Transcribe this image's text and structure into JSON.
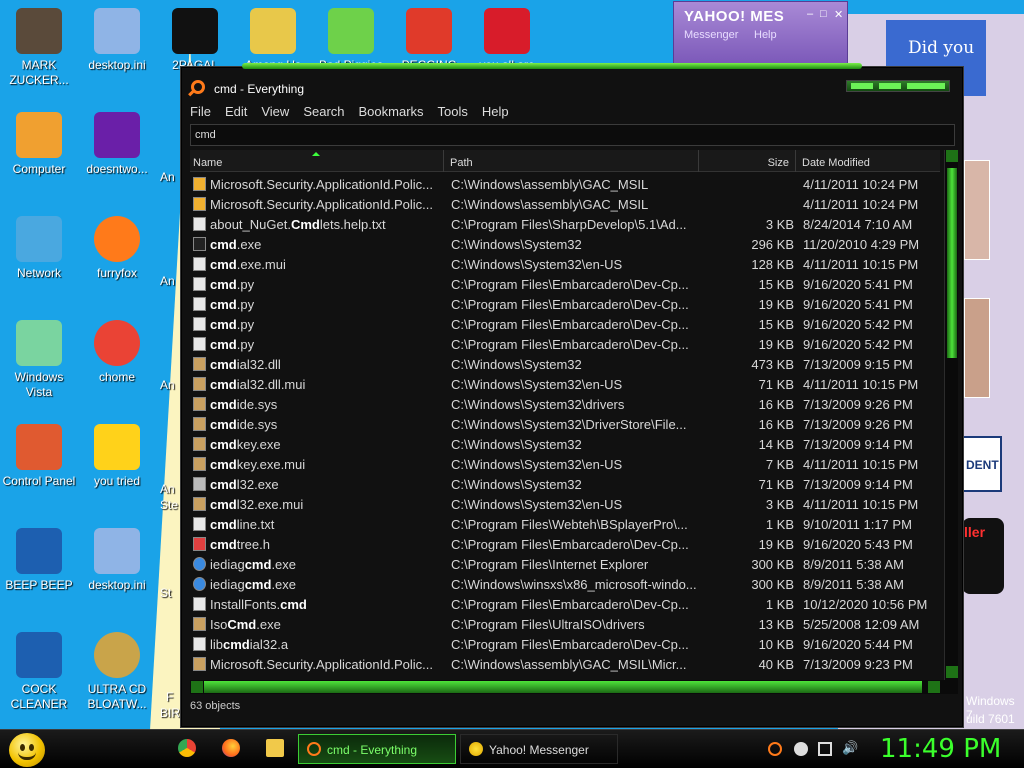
{
  "desktop": {
    "icons": [
      {
        "label": "MARK ZUCKER...",
        "icon": "user-icon",
        "color": "#5a4a3a"
      },
      {
        "label": "desktop.ini",
        "icon": "settings-file-icon",
        "color": "#8fb4e6"
      },
      {
        "label": "2PAGAL",
        "icon": "cmd-icon",
        "color": "#111111"
      },
      {
        "label": "Among Us",
        "icon": "folder-icon",
        "color": "#e8c84a"
      },
      {
        "label": "Bad Piggies",
        "icon": "pig-icon",
        "color": "#6ed14a"
      },
      {
        "label": "PECGINC",
        "icon": "p-app-icon",
        "color": "#e03a2a"
      },
      {
        "label": "you all are",
        "icon": "devcpp-icon",
        "color": "#d81c2a"
      },
      {
        "label": "Computer",
        "icon": "computer-icon",
        "color": "#f0a030"
      },
      {
        "label": "doesntwo...",
        "icon": "yahoo-icon",
        "color": "#6a1fa8"
      },
      {
        "label": "Network",
        "icon": "network-icon",
        "color": "#4aa8e0"
      },
      {
        "label": "furryfox",
        "icon": "firefox-icon",
        "color": "#ff7a1a"
      },
      {
        "label": "Windows Vista",
        "icon": "recycle-bin-icon",
        "color": "#7ad4a0"
      },
      {
        "label": "chome",
        "icon": "chrome-icon",
        "color": "#ea4335"
      },
      {
        "label": "Control Panel",
        "icon": "control-panel-icon",
        "color": "#e05a30"
      },
      {
        "label": "you tried",
        "icon": "star-icon",
        "color": "#ffd21a"
      },
      {
        "label": "BEEP BEEP",
        "icon": "book-icon",
        "color": "#1d5fb0"
      },
      {
        "label": "desktop.ini",
        "icon": "settings-file-icon",
        "color": "#8fb4e6"
      },
      {
        "label": "COCK CLEANER",
        "icon": "book-icon",
        "color": "#1d5fb0"
      },
      {
        "label": "ULTRA CD BLOATW...",
        "icon": "cd-icon",
        "color": "#c9a44a"
      }
    ],
    "partial_labels": [
      "An",
      "An",
      "An",
      "An",
      "Ste",
      "St",
      "F",
      "BIR"
    ],
    "right_fragments": {
      "did_you": "Did you",
      "ident": "DENT",
      "win_text": "Windows 7",
      "build": "uild 7601",
      "red_text": "ller"
    }
  },
  "yahoo": {
    "title": "YAHOO! MES",
    "menu1": "Messenger",
    "menu2": "Help"
  },
  "window": {
    "title": "cmd - Everything",
    "menu": [
      "File",
      "Edit",
      "View",
      "Search",
      "Bookmarks",
      "Tools",
      "Help"
    ],
    "search_value": "cmd",
    "columns": {
      "name": "Name",
      "path": "Path",
      "size": "Size",
      "date": "Date Modified"
    },
    "status": "63 objects",
    "rows": [
      {
        "pre": "Microsoft.Security.ApplicationId.Polic...",
        "hl": "",
        "post": "",
        "path": "C:\\Windows\\assembly\\GAC_MSIL",
        "size": "",
        "date": "4/11/2011 10:24 PM",
        "icon": "folder-icon"
      },
      {
        "pre": "Microsoft.Security.ApplicationId.Polic...",
        "hl": "",
        "post": "",
        "path": "C:\\Windows\\assembly\\GAC_MSIL",
        "size": "",
        "date": "4/11/2011 10:24 PM",
        "icon": "folder-icon"
      },
      {
        "pre": "about_NuGet.",
        "hl": "Cmd",
        "post": "lets.help.txt",
        "path": "C:\\Program Files\\SharpDevelop\\5.1\\Ad...",
        "size": "3 KB",
        "date": "8/24/2014 7:10 AM",
        "icon": "text-file-icon"
      },
      {
        "pre": "",
        "hl": "cmd",
        "post": ".exe",
        "path": "C:\\Windows\\System32",
        "size": "296 KB",
        "date": "11/20/2010 4:29 PM",
        "icon": "cmd-icon"
      },
      {
        "pre": "",
        "hl": "cmd",
        "post": ".exe.mui",
        "path": "C:\\Windows\\System32\\en-US",
        "size": "128 KB",
        "date": "4/11/2011 10:15 PM",
        "icon": "file-icon"
      },
      {
        "pre": "",
        "hl": "cmd",
        "post": ".py",
        "path": "C:\\Program Files\\Embarcadero\\Dev-Cp...",
        "size": "15 KB",
        "date": "9/16/2020 5:41 PM",
        "icon": "file-icon"
      },
      {
        "pre": "",
        "hl": "cmd",
        "post": ".py",
        "path": "C:\\Program Files\\Embarcadero\\Dev-Cp...",
        "size": "19 KB",
        "date": "9/16/2020 5:41 PM",
        "icon": "file-icon"
      },
      {
        "pre": "",
        "hl": "cmd",
        "post": ".py",
        "path": "C:\\Program Files\\Embarcadero\\Dev-Cp...",
        "size": "15 KB",
        "date": "9/16/2020 5:42 PM",
        "icon": "file-icon"
      },
      {
        "pre": "",
        "hl": "cmd",
        "post": ".py",
        "path": "C:\\Program Files\\Embarcadero\\Dev-Cp...",
        "size": "19 KB",
        "date": "9/16/2020 5:42 PM",
        "icon": "file-icon"
      },
      {
        "pre": "",
        "hl": "cmd",
        "post": "ial32.dll",
        "path": "C:\\Windows\\System32",
        "size": "473 KB",
        "date": "7/13/2009 9:15 PM",
        "icon": "dll-icon"
      },
      {
        "pre": "",
        "hl": "cmd",
        "post": "ial32.dll.mui",
        "path": "C:\\Windows\\System32\\en-US",
        "size": "71 KB",
        "date": "4/11/2011 10:15 PM",
        "icon": "dll-icon"
      },
      {
        "pre": "",
        "hl": "cmd",
        "post": "ide.sys",
        "path": "C:\\Windows\\System32\\drivers",
        "size": "16 KB",
        "date": "7/13/2009 9:26 PM",
        "icon": "sys-icon"
      },
      {
        "pre": "",
        "hl": "cmd",
        "post": "ide.sys",
        "path": "C:\\Windows\\System32\\DriverStore\\File...",
        "size": "16 KB",
        "date": "7/13/2009 9:26 PM",
        "icon": "sys-icon"
      },
      {
        "pre": "",
        "hl": "cmd",
        "post": "key.exe",
        "path": "C:\\Windows\\System32",
        "size": "14 KB",
        "date": "7/13/2009 9:14 PM",
        "icon": "exe-icon"
      },
      {
        "pre": "",
        "hl": "cmd",
        "post": "key.exe.mui",
        "path": "C:\\Windows\\System32\\en-US",
        "size": "7 KB",
        "date": "4/11/2011 10:15 PM",
        "icon": "dll-icon"
      },
      {
        "pre": "",
        "hl": "cmd",
        "post": "l32.exe",
        "path": "C:\\Windows\\System32",
        "size": "71 KB",
        "date": "7/13/2009 9:14 PM",
        "icon": "gear-file-icon"
      },
      {
        "pre": "",
        "hl": "cmd",
        "post": "l32.exe.mui",
        "path": "C:\\Windows\\System32\\en-US",
        "size": "3 KB",
        "date": "4/11/2011 10:15 PM",
        "icon": "dll-icon"
      },
      {
        "pre": "",
        "hl": "cmd",
        "post": "line.txt",
        "path": "C:\\Program Files\\Webteh\\BSplayerPro\\...",
        "size": "1 KB",
        "date": "9/10/2011 1:17 PM",
        "icon": "text-file-icon"
      },
      {
        "pre": "",
        "hl": "cmd",
        "post": "tree.h",
        "path": "C:\\Program Files\\Embarcadero\\Dev-Cp...",
        "size": "19 KB",
        "date": "9/16/2020 5:43 PM",
        "icon": "header-file-icon"
      },
      {
        "pre": "iediag",
        "hl": "cmd",
        "post": ".exe",
        "path": "C:\\Program Files\\Internet Explorer",
        "size": "300 KB",
        "date": "8/9/2011 5:38 AM",
        "icon": "ie-icon"
      },
      {
        "pre": "iediag",
        "hl": "cmd",
        "post": ".exe",
        "path": "C:\\Windows\\winsxs\\x86_microsoft-windo...",
        "size": "300 KB",
        "date": "8/9/2011 5:38 AM",
        "icon": "ie-icon"
      },
      {
        "pre": "InstallFonts.",
        "hl": "cmd",
        "post": "",
        "path": "C:\\Program Files\\Embarcadero\\Dev-Cp...",
        "size": "1 KB",
        "date": "10/12/2020 10:56 PM",
        "icon": "file-icon"
      },
      {
        "pre": "Iso",
        "hl": "Cmd",
        "post": ".exe",
        "path": "C:\\Program Files\\UltraISO\\drivers",
        "size": "13 KB",
        "date": "5/25/2008 12:09 AM",
        "icon": "exe-icon"
      },
      {
        "pre": "lib",
        "hl": "cmd",
        "post": "ial32.a",
        "path": "C:\\Program Files\\Embarcadero\\Dev-Cp...",
        "size": "10 KB",
        "date": "9/16/2020 5:44 PM",
        "icon": "file-icon"
      },
      {
        "pre": "Microsoft.Security.ApplicationId.Polic...",
        "hl": "",
        "post": "",
        "path": "C:\\Windows\\assembly\\GAC_MSIL\\Micr...",
        "size": "40 KB",
        "date": "7/13/2009 9:23 PM",
        "icon": "dll-icon"
      }
    ]
  },
  "taskbar": {
    "quick_launch": [
      "chrome-icon",
      "firefox-icon",
      "folder-icon"
    ],
    "buttons": [
      {
        "label": "cmd - Everything",
        "icon": "everything-search-icon"
      },
      {
        "label": "Yahoo! Messenger",
        "icon": "yahoo-icon"
      }
    ],
    "clock": "11:49 PM"
  },
  "colors": {
    "accent": "#3bff2c",
    "desktop": "#1aa3e8",
    "window_bg": "#111111"
  }
}
